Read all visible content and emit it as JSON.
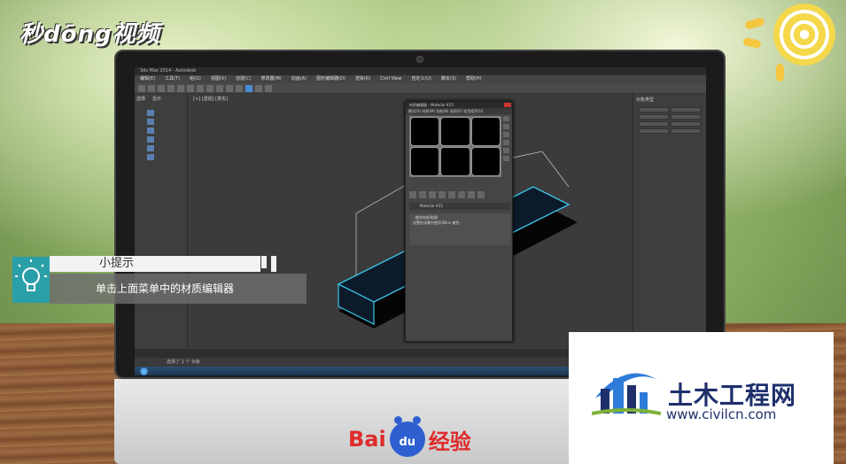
{
  "watermark": {
    "brand": "秒dōng视频"
  },
  "window": {
    "title": "3ds Max 2014 · Autodesk"
  },
  "menu": [
    "编辑(E)",
    "工具(T)",
    "组(G)",
    "视图(V)",
    "创建(C)",
    "修改器(M)",
    "动画(A)",
    "图形编辑器(D)",
    "渲染(R)",
    "Civil View",
    "自定义(U)",
    "脚本(S)",
    "帮助(H)"
  ],
  "scene_panel": {
    "tab_select": "选择",
    "tab_display": "显示"
  },
  "viewport": {
    "label": "[+] [透视] [真实]"
  },
  "material_editor": {
    "title": "材质编辑器 - Material #25",
    "menu": "模式(D)  材质(M)  导航(N)  选项(O)  实用程序(U)",
    "material_name": "Material #25",
    "rollout_title": "- 融合材质/贴图",
    "rollout_body": "设置在场景中使用 Blinn 着色"
  },
  "right_panel": {
    "header": "对象类型"
  },
  "status": {
    "line": "选择了 1 个 对象"
  },
  "tip": {
    "title": "小提示",
    "body": "单击上面菜单中的材质编辑器"
  },
  "baidu": {
    "text_left": "Bai",
    "paw_text": "du",
    "text_right": "经验"
  },
  "civil": {
    "name": "土木工程网",
    "url": "www.civilcn.com"
  },
  "colors": {
    "tip_accent": "#2b9fa8",
    "baidu_red": "#de2b2b",
    "baidu_blue": "#2e5fd1",
    "civil_blue": "#1e2f6b",
    "object_outline": "#3cc4e8"
  }
}
